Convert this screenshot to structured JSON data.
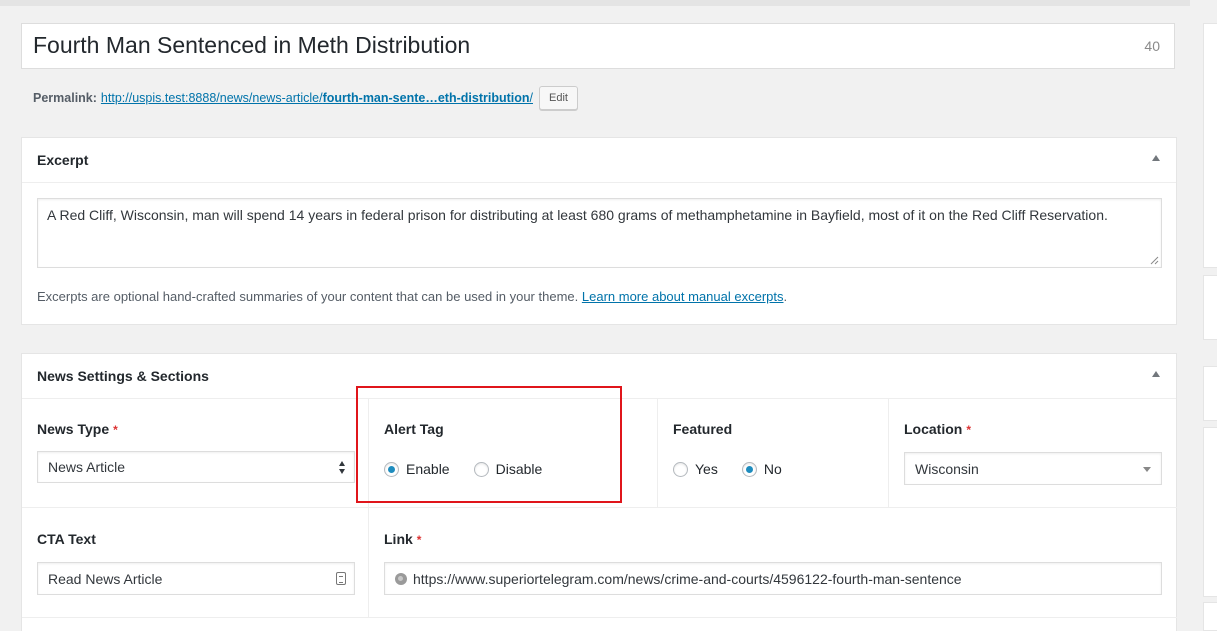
{
  "post": {
    "title": "Fourth Man Sentenced in Meth Distribution",
    "title_count": "40"
  },
  "permalink": {
    "label": "Permalink:",
    "url_prefix": "http://uspis.test:8888/news/news-article/",
    "slug": "fourth-man-sente…eth-distribution",
    "url_suffix": "/",
    "edit_label": "Edit"
  },
  "excerpt": {
    "heading": "Excerpt",
    "text": "A Red Cliff, Wisconsin, man will spend 14 years in federal prison for distributing at least 680 grams of methamphetamine in Bayfield, most of it on the Red Cliff Reservation.",
    "help_text": "Excerpts are optional hand-crafted summaries of your content that can be used in your theme.",
    "help_link": "Learn more about manual excerpts",
    "help_end": "."
  },
  "news_settings": {
    "heading": "News Settings & Sections",
    "required_mark": "*",
    "news_type": {
      "label": "News Type",
      "value": "News Article"
    },
    "alert_tag": {
      "label": "Alert Tag",
      "options": [
        "Enable",
        "Disable"
      ],
      "selected": "Enable"
    },
    "featured": {
      "label": "Featured",
      "options": [
        "Yes",
        "No"
      ],
      "selected": "No"
    },
    "location": {
      "label": "Location",
      "value": "Wisconsin"
    },
    "cta_text": {
      "label": "CTA Text",
      "value": "Read News Article"
    },
    "link": {
      "label": "Link",
      "value": "https://www.superiortelegram.com/news/crime-and-courts/4596122-fourth-man-sentence"
    }
  },
  "colors": {
    "link": "#0073aa",
    "required": "#dc3232",
    "highlight_box": "#e0151b",
    "radio_checked": "#1e8cbe"
  }
}
